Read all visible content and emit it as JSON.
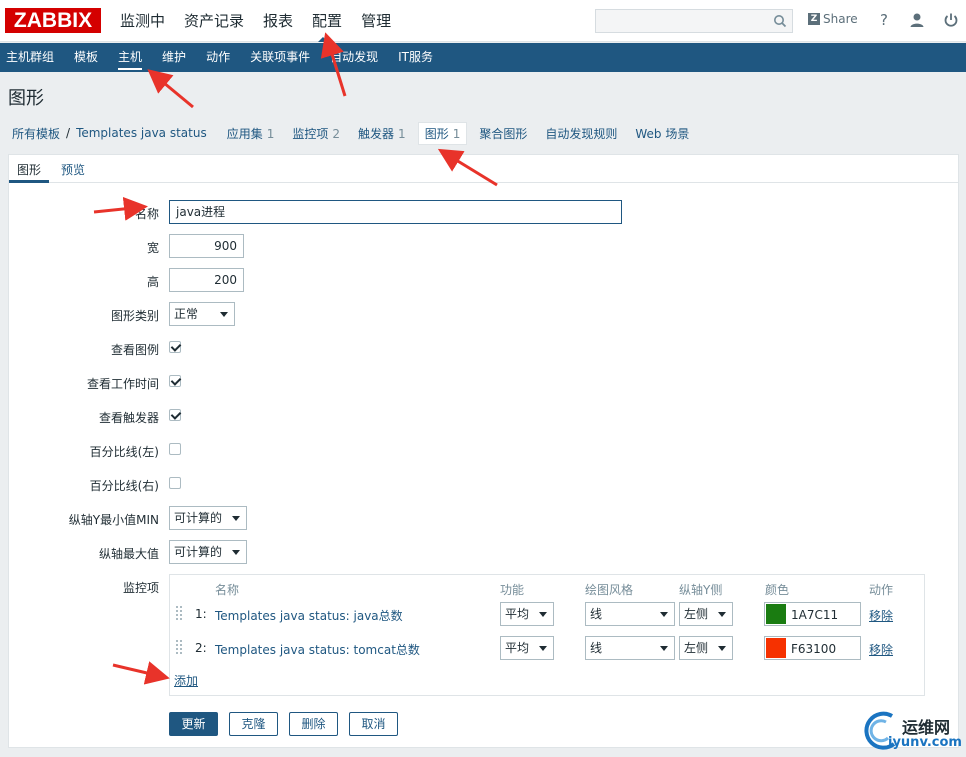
{
  "app": {
    "logo_text": "ZABBIX",
    "brand_color": "#d40000",
    "accent_color": "#1f5781"
  },
  "main_menu": [
    "监测中",
    "资产记录",
    "报表",
    "配置",
    "管理"
  ],
  "main_menu_selected": "配置",
  "search": {
    "value": ""
  },
  "share_label": "Share",
  "topbar_icons": [
    "help-icon",
    "user-icon",
    "power-icon"
  ],
  "sub_menu": [
    "主机群组",
    "模板",
    "主机",
    "维护",
    "动作",
    "关联项事件",
    "自动发现",
    "IT服务"
  ],
  "sub_menu_selected": "主机",
  "page_title": "图形",
  "breadcrumb": {
    "all_templates": "所有模板",
    "separator": "/",
    "template": "Templates java status",
    "tabs": [
      {
        "label": "应用集",
        "count": "1"
      },
      {
        "label": "监控项",
        "count": "2"
      },
      {
        "label": "触发器",
        "count": "1"
      },
      {
        "label": "图形",
        "count": "1"
      },
      {
        "label": "聚合图形",
        "count": ""
      },
      {
        "label": "自动发现规则",
        "count": ""
      },
      {
        "label": "Web 场景",
        "count": ""
      }
    ]
  },
  "form_tabs": {
    "graph": "图形",
    "preview": "预览"
  },
  "form": {
    "name_label": "名称",
    "name_value": "java进程",
    "width_label": "宽",
    "width_value": "900",
    "height_label": "高",
    "height_value": "200",
    "graph_type_label": "图形类别",
    "graph_type_value": "正常",
    "show_legend_label": "查看图例",
    "show_legend": true,
    "show_work_period_label": "查看工作时间",
    "show_work_period": true,
    "show_triggers_label": "查看触发器",
    "show_triggers": true,
    "percentile_left_label": "百分比线(左)",
    "percentile_left": false,
    "percentile_right_label": "百分比线(右)",
    "percentile_right": false,
    "ymin_label": "纵轴Y最小值MIN",
    "ymin_value": "可计算的",
    "ymax_label": "纵轴最大值",
    "ymax_value": "可计算的",
    "items_label": "监控项"
  },
  "items_table": {
    "headers": {
      "name": "名称",
      "function": "功能",
      "draw_style": "绘图风格",
      "y_axis": "纵轴Y侧",
      "color": "颜色",
      "action": "动作"
    },
    "rows": [
      {
        "index": "1:",
        "name": "Templates java status: java总数",
        "function": "平均",
        "draw_style": "线",
        "y_axis": "左侧",
        "color": "1A7C11",
        "color_hex": "#1a7c11",
        "action": "移除"
      },
      {
        "index": "2:",
        "name": "Templates java status: tomcat总数",
        "function": "平均",
        "draw_style": "线",
        "y_axis": "左侧",
        "color": "F63100",
        "color_hex": "#f63100",
        "action": "移除"
      }
    ],
    "add_label": "添加"
  },
  "buttons": {
    "update": "更新",
    "clone": "克隆",
    "delete": "删除",
    "cancel": "取消"
  },
  "watermark": {
    "line1": "运维网",
    "line2": "iyunv.com"
  }
}
